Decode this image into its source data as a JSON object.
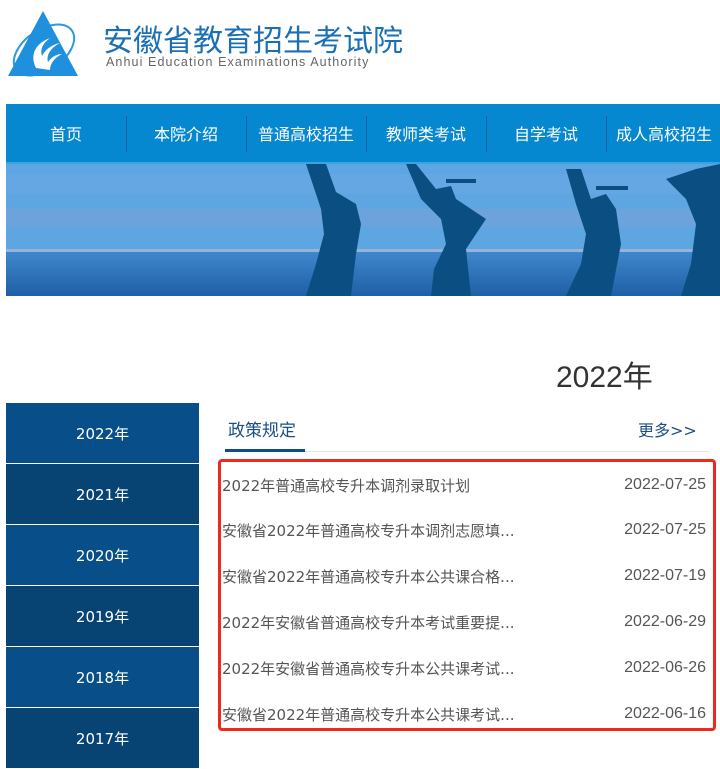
{
  "header": {
    "logo_icon": "triangle-flame-logo",
    "title": "安徽省教育招生考试院",
    "subtitle": "Anhui Education Examinations Authority"
  },
  "nav": {
    "items": [
      {
        "label": "首页"
      },
      {
        "label": "本院介绍"
      },
      {
        "label": "普通高校招生"
      },
      {
        "label": "教师类考试"
      },
      {
        "label": "自学考试"
      },
      {
        "label": "成人高校招生"
      }
    ]
  },
  "banner": {
    "description": "graduates-jumping-over-sea"
  },
  "page": {
    "year_heading": "2022年"
  },
  "sidebar": {
    "items": [
      {
        "label": "2022年"
      },
      {
        "label": "2021年"
      },
      {
        "label": "2020年"
      },
      {
        "label": "2019年"
      },
      {
        "label": "2018年"
      },
      {
        "label": "2017年"
      }
    ]
  },
  "section": {
    "tab_label": "政策规定",
    "more_label": "更多>>",
    "highlight_color": "#ee2a1e",
    "items": [
      {
        "title": "2022年普通高校专升本调剂录取计划",
        "date": "2022-07-25"
      },
      {
        "title": "安徽省2022年普通高校专升本调剂志愿填...",
        "date": "2022-07-25"
      },
      {
        "title": "安徽省2022年普通高校专升本公共课合格...",
        "date": "2022-07-19"
      },
      {
        "title": "2022年安徽省普通高校专升本考试重要提...",
        "date": "2022-06-29"
      },
      {
        "title": "2022年安徽省普通高校专升本公共课考试...",
        "date": "2022-06-26"
      },
      {
        "title": "安徽省2022年普通高校专升本公共课考试...",
        "date": "2022-06-16"
      }
    ]
  }
}
